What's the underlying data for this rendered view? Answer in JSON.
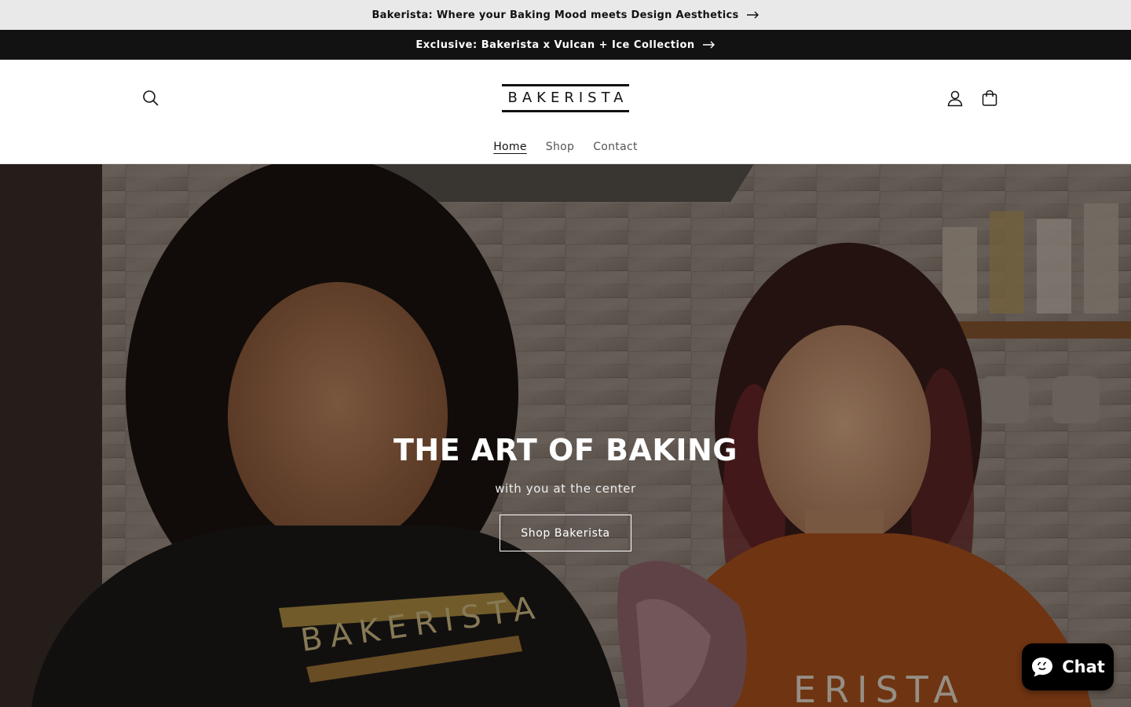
{
  "announcements": [
    {
      "text": "Bakerista: Where your Baking Mood meets Design Aesthetics"
    },
    {
      "text": "Exclusive: Bakerista x Vulcan + Ice Collection"
    }
  ],
  "header": {
    "logo_text": "BAKERISTA",
    "icons": {
      "search": "search-icon",
      "account": "user-icon",
      "cart": "bag-icon"
    }
  },
  "nav": {
    "items": [
      {
        "label": "Home",
        "active": true
      },
      {
        "label": "Shop",
        "active": false
      },
      {
        "label": "Contact",
        "active": false
      }
    ]
  },
  "hero": {
    "title": "THE ART OF BAKING",
    "subtitle": "with you at the center",
    "cta_label": "Shop Bakerista"
  },
  "chat": {
    "label": "Chat",
    "icon": "chat-bubble-icon"
  }
}
